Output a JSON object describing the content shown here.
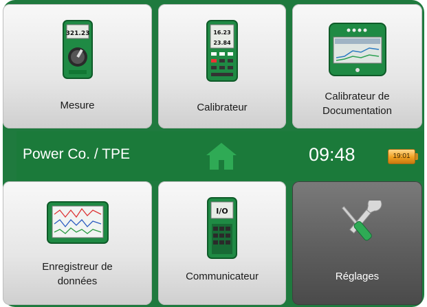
{
  "tiles": {
    "mesure": {
      "label": "Mesure",
      "display_value": "321.23"
    },
    "calibrateur": {
      "label": "Calibrateur",
      "display_top": "16.23",
      "display_bottom": "23.84"
    },
    "calibrateur_doc": {
      "label": "Calibrateur de\nDocumentation"
    },
    "enregistreur": {
      "label": "Enregistreur de\ndonnées"
    },
    "communicateur": {
      "label": "Communicateur",
      "display_value": "I/O"
    },
    "reglages": {
      "label": "Réglages"
    }
  },
  "status_bar": {
    "company": "Power Co. / TPE",
    "time": "09:48",
    "battery_label": "19:01"
  },
  "colors": {
    "frame_green": "#1f7a3e",
    "home_icon": "#2faa55",
    "battery": "#f0a020",
    "settings_tile": "#5e5e5e"
  },
  "icons": {
    "home": "home-icon",
    "settings": "wrench-screwdriver-icon",
    "battery": "battery-icon"
  }
}
